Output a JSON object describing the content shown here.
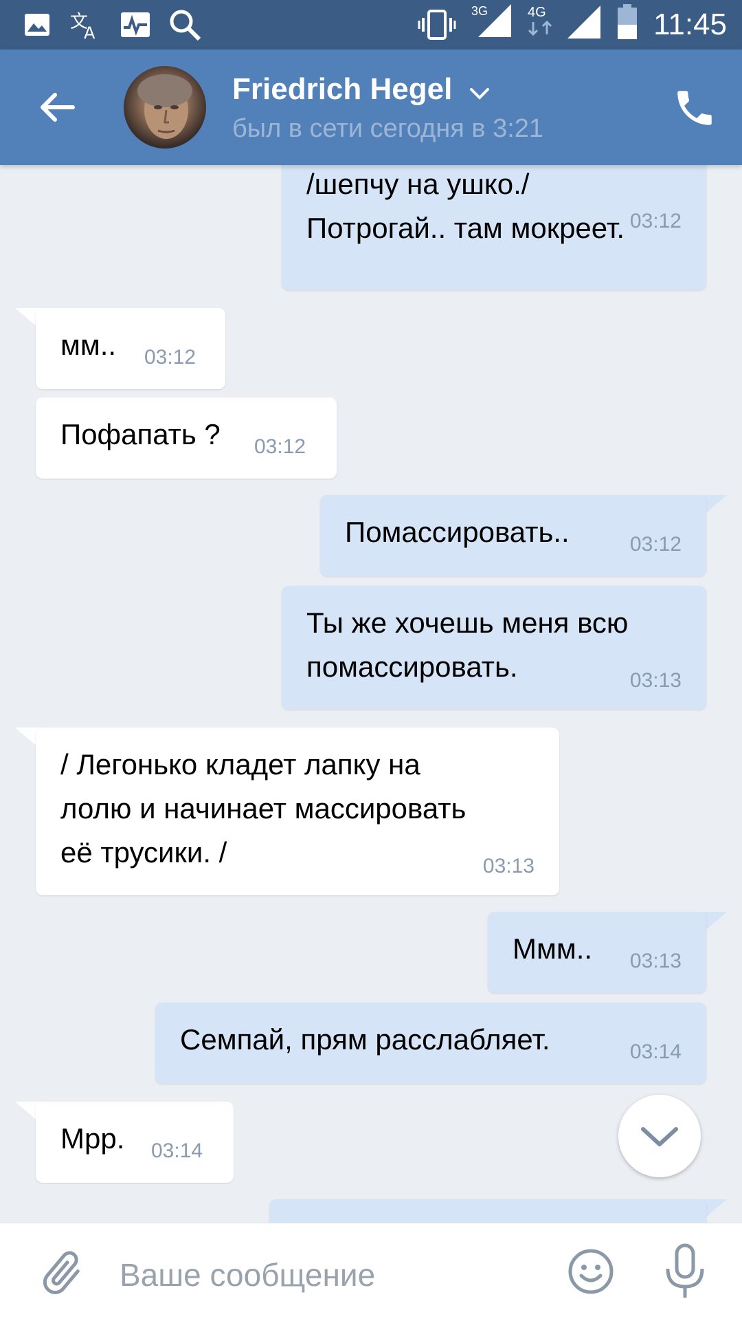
{
  "status_bar": {
    "network_3g": "3G",
    "network_4g": "4G",
    "time": "11:45"
  },
  "header": {
    "contact_name": "Friedrich Hegel",
    "last_seen": "был в сети сегодня в 3:21"
  },
  "messages": [
    {
      "direction": "out",
      "text": "/шепчу на ушко./\nПотрогай.. там мокреет.",
      "time": "03:12"
    },
    {
      "direction": "in",
      "text": "мм..",
      "time": "03:12"
    },
    {
      "direction": "in",
      "text": "Пофапать ?",
      "time": "03:12"
    },
    {
      "direction": "out",
      "text": "Помассировать..",
      "time": "03:12"
    },
    {
      "direction": "out",
      "text": "Ты же хочешь меня всю\nпомассировать.",
      "time": "03:13"
    },
    {
      "direction": "in",
      "text": "/ Легонько кладет лапку на\nлолю и начинает массировать\nеё трусики. /",
      "time": "03:13"
    },
    {
      "direction": "out",
      "text": "Ммм..",
      "time": "03:13"
    },
    {
      "direction": "out",
      "text": "Семпай, прям расслабляет.",
      "time": "03:14"
    },
    {
      "direction": "in",
      "text": "Мрр.",
      "time": "03:14"
    }
  ],
  "composer": {
    "placeholder": "Ваше сообщение"
  },
  "colors": {
    "status_bar": "#3b5c85",
    "header": "#5181b8",
    "chat_background": "#ebeff4",
    "outgoing_bubble": "#d5e4f6",
    "incoming_bubble": "#ffffff"
  }
}
